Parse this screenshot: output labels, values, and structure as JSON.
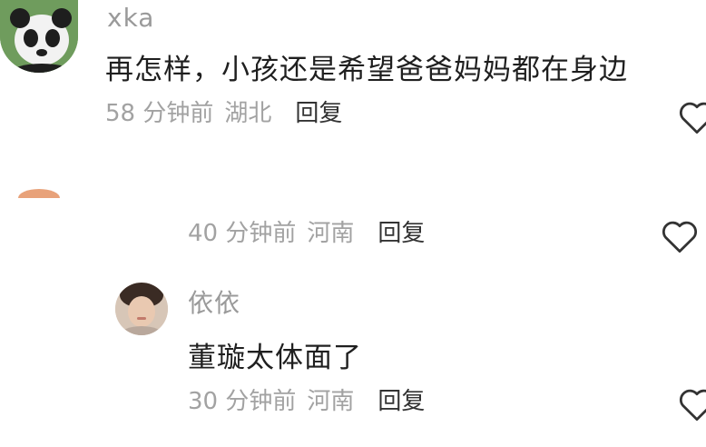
{
  "comments": [
    {
      "username": "xka",
      "text": "再怎样，小孩还是希望爸爸妈妈都在身边",
      "time": "58 分钟前",
      "location": "湖北",
      "reply_label": "回复"
    },
    {
      "username": "",
      "text": "",
      "time": "40 分钟前",
      "location": "河南",
      "reply_label": "回复"
    },
    {
      "username": "依依",
      "text": "董璇太体面了",
      "time": "30 分钟前",
      "location": "河南",
      "reply_label": "回复"
    }
  ],
  "icons": {
    "like": "heart-outline-icon",
    "avatar_1": "panda-avatar",
    "avatar_3": "portrait-avatar"
  },
  "colors": {
    "meta_text": "#a2a2a2",
    "username": "#9a9a9a",
    "body_text": "#1f1f1f",
    "reply": "#333333"
  }
}
